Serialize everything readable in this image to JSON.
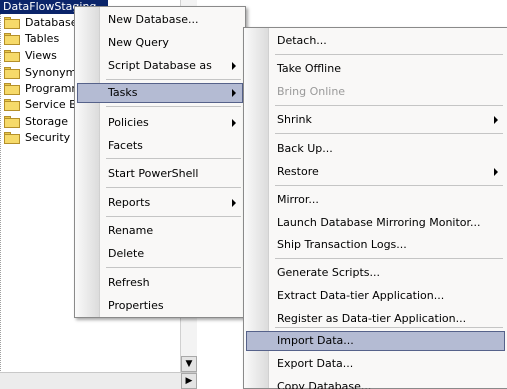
{
  "tree": {
    "selected_node": "DataFlowStaging",
    "nodes": [
      {
        "label": "Database"
      },
      {
        "label": "Tables"
      },
      {
        "label": "Views"
      },
      {
        "label": "Synonyms"
      },
      {
        "label": "Programm"
      },
      {
        "label": "Service Br"
      },
      {
        "label": "Storage"
      },
      {
        "label": "Security"
      }
    ]
  },
  "database_menu": {
    "items": [
      {
        "label": "New Database..."
      },
      {
        "label": "New Query"
      },
      {
        "label": "Script Database as"
      },
      {
        "label": "Tasks"
      },
      {
        "label": "Policies"
      },
      {
        "label": "Facets"
      },
      {
        "label": "Start PowerShell"
      },
      {
        "label": "Reports"
      },
      {
        "label": "Rename"
      },
      {
        "label": "Delete"
      },
      {
        "label": "Refresh"
      },
      {
        "label": "Properties"
      }
    ]
  },
  "tasks_menu": {
    "items": [
      {
        "label": "Detach..."
      },
      {
        "label": "Take Offline"
      },
      {
        "label": "Bring Online"
      },
      {
        "label": "Shrink"
      },
      {
        "label": "Back Up..."
      },
      {
        "label": "Restore"
      },
      {
        "label": "Mirror..."
      },
      {
        "label": "Launch Database Mirroring Monitor..."
      },
      {
        "label": "Ship Transaction Logs..."
      },
      {
        "label": "Generate Scripts..."
      },
      {
        "label": "Extract Data-tier Application..."
      },
      {
        "label": "Register as Data-tier Application..."
      },
      {
        "label": "Import Data..."
      },
      {
        "label": "Export Data..."
      },
      {
        "label": "Copy Database..."
      }
    ]
  }
}
